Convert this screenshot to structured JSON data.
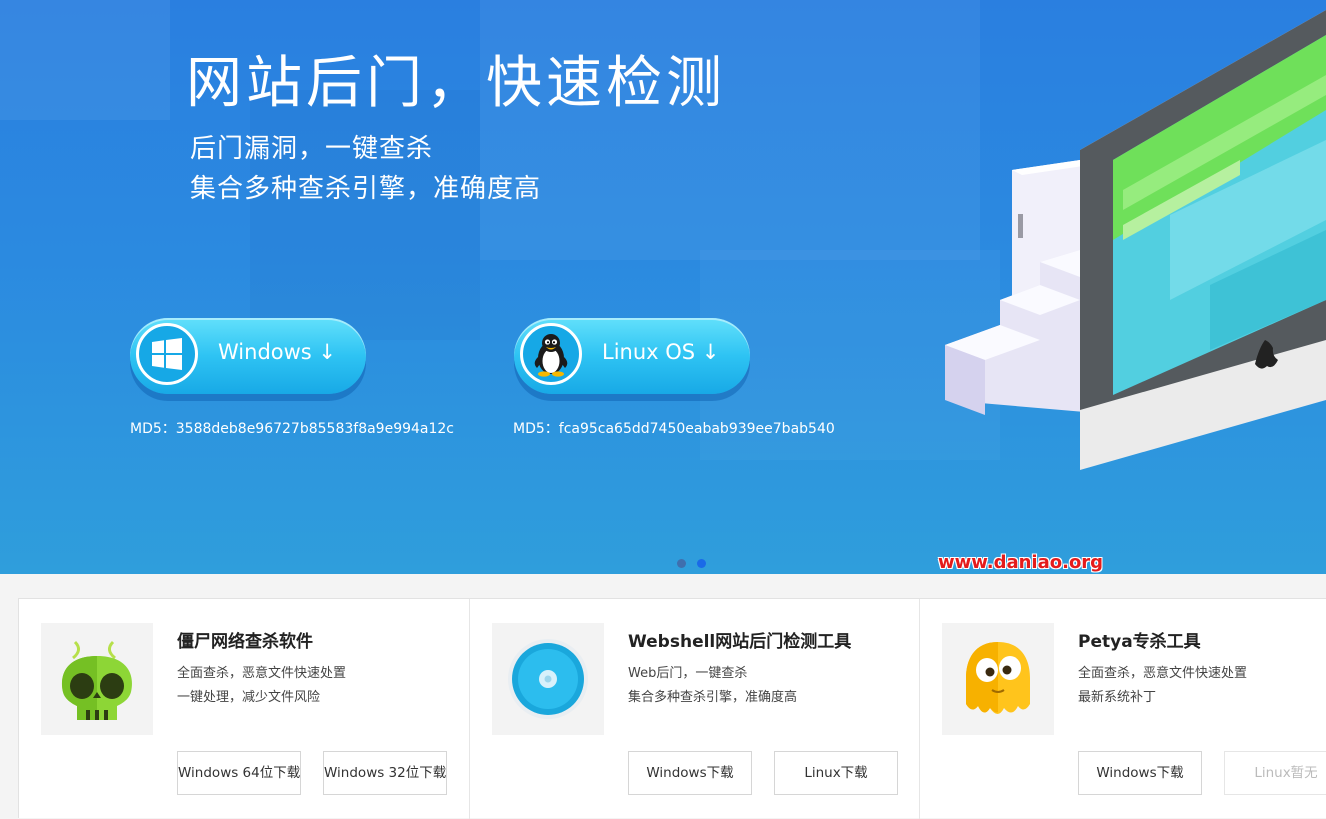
{
  "hero": {
    "title": "网站后门，快速检测",
    "subtitle_line1": "后门漏洞，一键查杀",
    "subtitle_line2": "集合多种查杀引擎，准确度高",
    "windows_button": {
      "label": "Windows ↓",
      "icon": "windows-logo-icon"
    },
    "linux_button": {
      "label": "Linux OS ↓",
      "icon": "penguin-icon"
    },
    "windows_md5": "MD5：3588deb8e96727b85583f8a9e994a12c",
    "linux_md5": "MD5：fca95ca65dd7450eabab939ee7bab540",
    "carousel": {
      "slides": 2,
      "active": 2
    },
    "watermark": "www.daniao.org",
    "colors": {
      "background_top": "#2a7fe0",
      "background_bottom": "#2f9edc",
      "button": "#2ec3f3",
      "watermark": "#e41b1b"
    }
  },
  "products": [
    {
      "title": "僵尸网络查杀软件",
      "desc1": "全面查杀，恶意文件快速处置",
      "desc2": "一键处理，减少文件风险",
      "icon": "green-skull-icon",
      "buttons": [
        {
          "label": "Windows 64位下载",
          "enabled": true
        },
        {
          "label": "Windows 32位下载",
          "enabled": true
        }
      ]
    },
    {
      "title": "Webshell网站后门检测工具",
      "desc1": "Web后门，一键查杀",
      "desc2": "集合多种查杀引擎，准确度高",
      "icon": "blue-disc-icon",
      "buttons": [
        {
          "label": "Windows下载",
          "enabled": true
        },
        {
          "label": "Linux下载",
          "enabled": true
        }
      ]
    },
    {
      "title": "Petya专杀工具",
      "desc1": "全面查杀，恶意文件快速处置",
      "desc2": "最新系统补丁",
      "icon": "yellow-ghost-icon",
      "buttons": [
        {
          "label": "Windows下载",
          "enabled": true
        },
        {
          "label": "Linux暂无",
          "enabled": false
        }
      ]
    }
  ]
}
